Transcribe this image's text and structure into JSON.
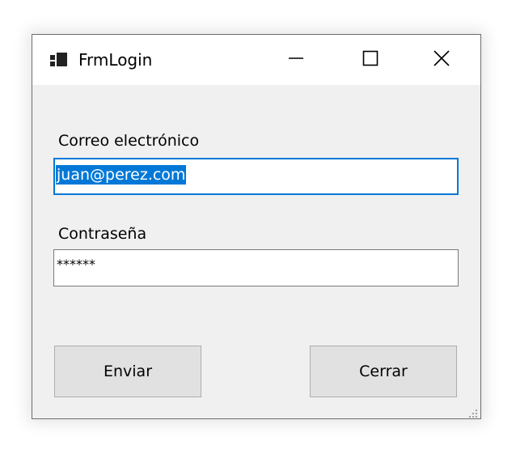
{
  "window": {
    "title": "FrmLogin"
  },
  "form": {
    "email_label": "Correo electrónico",
    "email_value": "juan@perez.com",
    "password_label": "Contraseña",
    "password_value": "******"
  },
  "buttons": {
    "submit_label": "Enviar",
    "close_label": "Cerrar"
  },
  "icons": {
    "app": "winforms-app-icon",
    "minimize": "minimize-icon",
    "maximize": "maximize-icon",
    "close": "close-icon",
    "grip": "resize-grip-icon"
  },
  "colors": {
    "accent": "#0078d7",
    "window_bg": "#f0f0f0",
    "titlebar_bg": "#ffffff",
    "button_bg": "#e1e1e1"
  }
}
